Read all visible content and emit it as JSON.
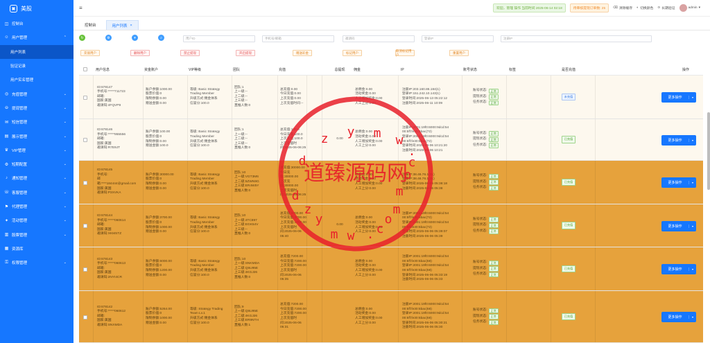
{
  "app": {
    "title": "美股"
  },
  "sidebar": {
    "items": [
      {
        "label": "控制台",
        "icon": "dashboard-icon",
        "type": "top"
      },
      {
        "label": "用户管理",
        "icon": "user-icon",
        "type": "group",
        "arrow": "⌃"
      },
      {
        "label": "用户列表",
        "icon": "",
        "type": "sub",
        "active": true
      },
      {
        "label": "验证记录",
        "icon": "",
        "type": "sub"
      },
      {
        "label": "用户实名管理",
        "icon": "",
        "type": "sub"
      },
      {
        "label": "充值管理",
        "icon": "wallet-icon",
        "type": "group",
        "arrow": "⌄"
      },
      {
        "label": "提现管理",
        "icon": "withdraw-icon",
        "type": "group",
        "arrow": "⌄"
      },
      {
        "label": "短信管理",
        "icon": "message-icon",
        "type": "group",
        "arrow": "⌄"
      },
      {
        "label": "展示管理",
        "icon": "display-icon",
        "type": "group",
        "arrow": "⌄"
      },
      {
        "label": "VIP管理",
        "icon": "vip-icon",
        "type": "group",
        "arrow": "⌄"
      },
      {
        "label": "短期配置",
        "icon": "settings-icon",
        "type": "group",
        "arrow": "⌄"
      },
      {
        "label": "通知管理",
        "icon": "bell-icon",
        "type": "group",
        "arrow": "⌄"
      },
      {
        "label": "客服管理",
        "icon": "support-icon",
        "type": "group",
        "arrow": "⌄"
      },
      {
        "label": "代理管理",
        "icon": "agent-icon",
        "type": "group",
        "arrow": "⌄"
      },
      {
        "label": "活动管理",
        "icon": "activity-icon",
        "type": "group",
        "arrow": "⌄"
      },
      {
        "label": "股票管理",
        "icon": "stock-icon",
        "type": "group",
        "arrow": "⌄"
      },
      {
        "label": "资源库",
        "icon": "library-icon",
        "type": "top"
      },
      {
        "label": "权限管理",
        "icon": "permission-icon",
        "type": "group",
        "arrow": "⌄"
      }
    ]
  },
  "header": {
    "notice_green": "欢迎，管理 操作 当前时间 2025-06-14 02:18",
    "notice_orange": "待审核提现订单数: 25",
    "clear_cache": "清除缓存",
    "toggle_theme": "切换颜色",
    "lock_screen": "长期验证",
    "user": "admin"
  },
  "tabs": [
    {
      "label": "控制台",
      "active": false
    },
    {
      "label": "用户列表",
      "active": true,
      "close": "×"
    }
  ],
  "filters": {
    "buttons": [
      {
        "icon": "refresh-icon",
        "glyph": "↻",
        "color": "#67c23a"
      },
      {
        "icon": "gear-icon",
        "glyph": "⚙",
        "color": "#409eff"
      },
      {
        "icon": "chevron-down-icon",
        "glyph": "▾",
        "color": "#409eff"
      },
      {
        "icon": "search-icon",
        "glyph": "⌕",
        "color": "#409eff"
      }
    ],
    "inputs": [
      "用户ID",
      "手机号/邮箱",
      "邀请码",
      "登录IP",
      "注册IP"
    ]
  },
  "actions": [
    {
      "label": "充值用户",
      "style": "orange"
    },
    {
      "label": "删除用户",
      "style": "red"
    },
    {
      "label": "禁止提现",
      "style": "red"
    },
    {
      "label": "开启提现",
      "style": "red"
    },
    {
      "label": "赠送彩金",
      "style": "orange"
    },
    {
      "label": "标记用户",
      "style": "orange"
    },
    {
      "label": "取消标记用户",
      "style": "orange"
    },
    {
      "label": "重置用户",
      "style": "orange"
    }
  ],
  "table": {
    "columns": [
      "用户信息",
      "资金账户",
      "VIP等级",
      "团队",
      "充值",
      "总提现",
      "佣金",
      "IP",
      "账号状态",
      "标签",
      "是否充值",
      "操作"
    ],
    "status_labels": [
      "账号状态:",
      "提现状态:",
      "任务状态:"
    ],
    "status_value": "正常",
    "more_label": "更多操作",
    "rows": [
      {
        "style": "light",
        "user": [
          "ID:678147",
          "手机号:*****711723",
          "邮箱:",
          "国家:美国",
          "邀请码:4FQVP9"
        ],
        "fund": [
          "账户余额:1000.00",
          "股票价值:0",
          "限制余额:0.00",
          "赠送金额:0.00"
        ],
        "vip": [
          "等级: Basic Strategy Trading Member",
          "升级方式:佣金体系",
          "信誉分:100.0"
        ],
        "team": [
          "团队:1",
          "上一级:--",
          "上二级:--",
          "上三级:--",
          "直推人数:0"
        ],
        "recharge": [
          "总充值:0.00",
          "今日充值:0.00",
          "上次充值:0.00",
          "上次充值时间:--"
        ],
        "withdraw": "",
        "commission": [
          "总佣金:0.00",
          "活动奖金:0.00",
          "人工增加奖金:0.00",
          "人工上分:0.00"
        ],
        "ip": [
          "注册IP:203.160.86.184(1)",
          "登录IP:151.242.10.143(1)",
          "登录时间:2025-06-13 05:22:12",
          "注册时间:2025-06-11 10:09"
        ],
        "recharged": "未充值",
        "recharged_no": true
      },
      {
        "style": "light",
        "user": [
          "ID:678146",
          "手机号:*****955556",
          "邮箱:",
          "国家:美国",
          "邀请码:R7E9JT"
        ],
        "fund": [
          "账户余额:100.00",
          "股票价值:0",
          "限制余额:0.00",
          "赠送金额:100.0"
        ],
        "vip": [
          "等级: Basic Strategy Trading Member",
          "升级方式:佣金体系",
          "信誉分:100.0"
        ],
        "team": [
          "团队:1",
          "上一级:--",
          "上二级:--",
          "上三级:--",
          "直推人数:0"
        ],
        "recharge": [
          "总充值:100.0",
          "今日充值:100.0",
          "上次充值:100.0",
          "上次充值时间:2025-06-06:25"
        ],
        "withdraw": "0.00",
        "commission": [
          "总佣金:0.00",
          "活动奖金:0.00",
          "人工增加奖金:0.00",
          "人工上分:0.00"
        ],
        "ip": [
          "注册IP:2001:19f0:6000:9dcd:54",
          "00:5ff:fe30:5bac(72)",
          "登录IP:2001:19f0:6000:9dcd:54",
          "00:5ff:fe30:5bac(72)",
          "登录时间:2025-06-06 10:21:20",
          "注册时间:2025-06-06 10:21"
        ],
        "recharged": "已充值",
        "recharged_no": false
      },
      {
        "style": "dark",
        "user": [
          "ID:678145",
          "手机号:",
          "邮箱:****184444@gmail.com",
          "国家:美国",
          "邀请码:P3XVKA"
        ],
        "fund": [
          "账户余额:30000.00",
          "股票价值:0",
          "限制余额:0.00",
          "赠送金额:0.00"
        ],
        "vip": [
          "等级: Basic Strategy Trading Member",
          "升级方式:佣金体系",
          "信誉分:100.0"
        ],
        "team": [
          "团队:10",
          "上一级:VGT3M6",
          "上二级:5ZWN9G",
          "上三级:ER4W5Y",
          "直推人数:0"
        ],
        "recharge": [
          "总充值:30000.00",
          "今日充值:30000.00",
          "上次充值:30000.00",
          "上次充值时间:2025-06-06:25"
        ],
        "withdraw": "",
        "commission": [
          "总佣金:0.00",
          "活动奖金:0.00",
          "人工增加奖金:0.00",
          "人工上分:0.00"
        ],
        "ip": [
          "注册IP:38.46.76.1(31)",
          "登录IP:38.46.76.1(31)",
          "登录时间:2025-06-06 05:38:18",
          "注册时间:2025-06-06 05:38"
        ],
        "recharged": "已充值",
        "recharged_no": false
      },
      {
        "style": "dark",
        "user": [
          "ID:678144",
          "手机号:*****060614",
          "邮箱:",
          "国家:美国",
          "邀请码:XKMSTZ"
        ],
        "fund": [
          "账户余额:3700.00",
          "股票价值:0",
          "限制余额:1000.00",
          "赠送金额:0.00"
        ],
        "vip": [
          "等级: Basic Strategy Trading Member",
          "升级方式:佣金体系",
          "信誉分:100.0"
        ],
        "team": [
          "团队:10",
          "上一级:4TC897",
          "上二级:EGK54V",
          "上三级:--",
          "直推人数:0"
        ],
        "recharge": [
          "总充值:3700.00",
          "今日充值:3700.00",
          "上次充值:3700.00",
          "上次充值时间:2025-06-06 05:40"
        ],
        "withdraw": "0.00",
        "commission": [
          "总佣金:0.00",
          "活动奖金:0.00",
          "人工增加奖金:0.00",
          "人工上分:0.00"
        ],
        "ip": [
          "注册IP:2001:19f0:6000:9dcd:54",
          "00:5ff:fe30:5bac(72)",
          "登录IP:2001:19f0:6000:9dcd:54",
          "00:5ff:fe30:5bac(72)",
          "登录时间:2025-06-06 05:39:07",
          "注册时间:2025-06-06 05:39"
        ],
        "recharged": "已充值",
        "recharged_no": false
      },
      {
        "style": "dark",
        "user": [
          "ID:678143",
          "手机号:*****060613",
          "邮箱:",
          "国家:美国",
          "邀请码:2NYI4CR"
        ],
        "fund": [
          "账户余额:6000.00",
          "股票价值:0",
          "限制余额:1200.00",
          "赠送金额:0.00"
        ],
        "vip": [
          "等级: Basic Strategy Trading Member",
          "升级方式:佣金体系",
          "信誉分:100.0"
        ],
        "team": [
          "团队:10",
          "上一级:SNKMDA",
          "上二级:Q5U95E",
          "上三级:4KGJ26",
          "直推人数:0"
        ],
        "recharge": [
          "总充值:7200.00",
          "今日充值:7200.00",
          "上次充值:7200.00",
          "上次充值时间:2025-06-06 05:35"
        ],
        "withdraw": "",
        "commission": [
          "总佣金:0.00",
          "活动奖金:0.00",
          "人工增加奖金:0.00",
          "人工上分:0.00"
        ],
        "ip": [
          "注册IP:2001:19f0:6000:9dcd:54",
          "00:5ff:fe30:5bac(68)",
          "登录IP:2001:19f0:6000:9dcd:54",
          "00:5ff:fe30:5bac(68)",
          "登录时间:2025-06-06 05:33:19",
          "注册时间:2025-06-06 05:33"
        ],
        "recharged": "已充值",
        "recharged_no": false
      },
      {
        "style": "dark",
        "user": [
          "ID:678142",
          "手机号:*****060612",
          "邮箱:",
          "国家:美国",
          "邀请码:SNXMDA"
        ],
        "fund": [
          "账户余额:5264.00",
          "股票价值:0",
          "限制余额:1000.00",
          "赠送金额:0.00"
        ],
        "vip": [
          "等级: Strategy Trading Team Lv.1",
          "升级方式:佣金体系",
          "信誉分:100.0"
        ],
        "team": [
          "团队:9",
          "上一级:Q5U95E",
          "上二级:4KGJ26",
          "上三级:ER9NTH",
          "直推人数:1"
        ],
        "recharge": [
          "总充值:7200.00",
          "今日充值:7200.00",
          "上次充值:7200.00",
          "上次充值时间:2025-06-06 05:31"
        ],
        "withdraw": "",
        "commission": [
          "总佣金:0.00",
          "活动奖金:0.00",
          "人工增加奖金:0.00",
          "人工上分:0.00"
        ],
        "ip": [
          "注册IP:2001:19f0:6000:9dcd:54",
          "00:5ff:fe30:5bac(68)",
          "登录IP:2001:19f0:6000:9dcd:54",
          "00:5ff:fe30:5bac(68)",
          "登录时间:2025-06-06 05:30:21",
          "注册时间:2025-06-06 05:30"
        ],
        "recharged": "已充值",
        "recharged_no": false
      }
    ]
  },
  "watermark": {
    "text": "道臻源码网",
    "letters_top": "dzymw.com",
    "letters_bottom": "dzymw.com",
    "color": "#e8202a"
  }
}
